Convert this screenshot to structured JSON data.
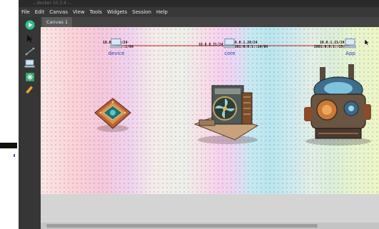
{
  "window": {
    "title": "...docker 10.3.4 ..."
  },
  "menu": [
    "File",
    "Edit",
    "Canvas",
    "View",
    "Tools",
    "Widgets",
    "Session",
    "Help"
  ],
  "tab": {
    "label": "Canvas 1"
  },
  "nodes": [
    {
      "label": "device"
    },
    {
      "label": "core"
    },
    {
      "label": "App"
    }
  ],
  "links": [
    {
      "a_ip4": "10.0.0.20/24",
      "a_ip6": "aaaa::1/64",
      "b_ip4": "10.0.0.21/24"
    },
    {
      "a_ip4": "10.0.1.20/24",
      "a_ip6": "2001:0:0:1::14/64",
      "b_ip4": "10.0.1.21/24",
      "b_ip6": "2001:0:0:1::15/64"
    }
  ],
  "colors": {
    "link": "#d42020",
    "accent_run": "#2fbf8f",
    "node_label": "#2244bb"
  },
  "icons": [
    "play-icon",
    "pointer-icon",
    "link-icon",
    "computer-icon",
    "network-icon",
    "pencil-icon"
  ]
}
